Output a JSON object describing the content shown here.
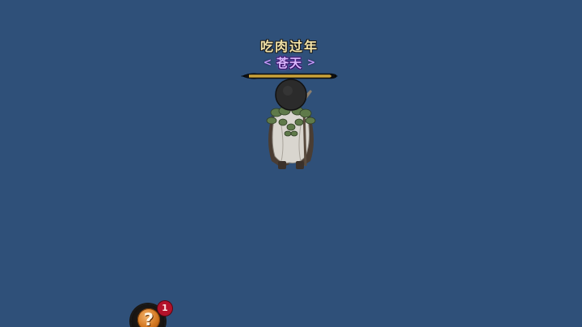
{
  "player": {
    "name": "吃肉过年",
    "title": "苍天",
    "title_arrow_left": "<",
    "title_arrow_right": ">",
    "health_fraction": 1.0
  },
  "hud": {
    "help_button": {
      "icon": "question-mark-icon",
      "glyph": "?",
      "badge_count": "1"
    }
  },
  "colors": {
    "background": "#2f5079",
    "name_text": "#f2e2a6",
    "title_text": "#d9b7ff",
    "health_fill": "#c9a23a",
    "badge": "#b3122a",
    "help_icon": "#d2761f"
  }
}
